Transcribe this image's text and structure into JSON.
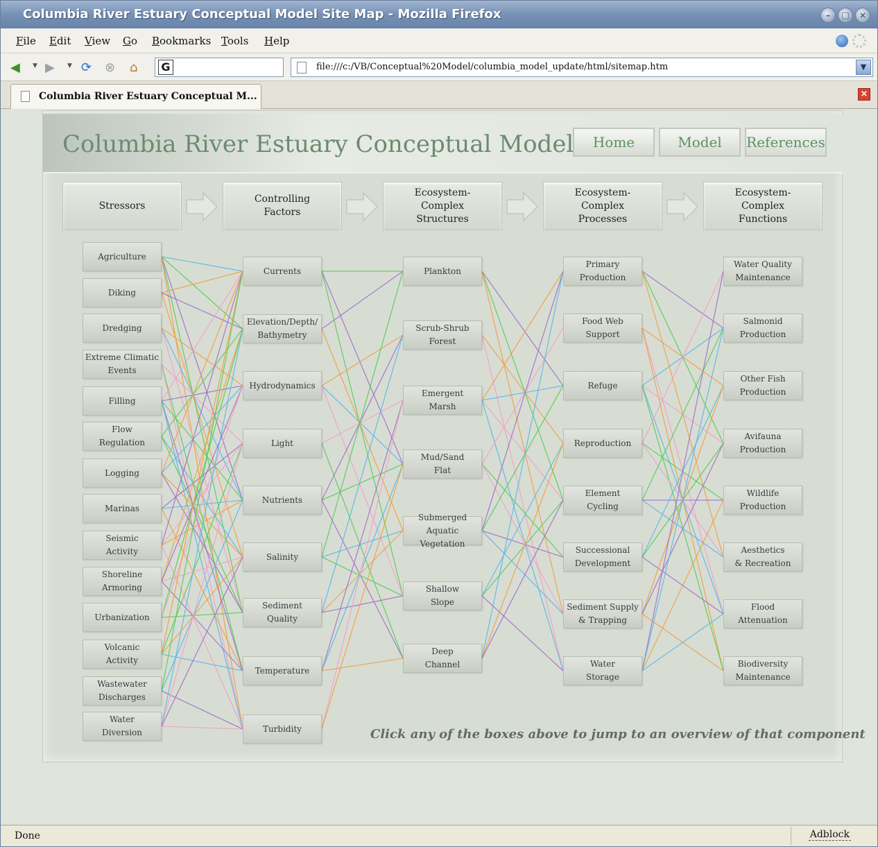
{
  "window": {
    "title": "Columbia River Estuary Conceptual Model Site Map - Mozilla Firefox",
    "controls": [
      "minimize",
      "maximize",
      "close"
    ]
  },
  "menu": [
    "File",
    "Edit",
    "View",
    "Go",
    "Bookmarks",
    "Tools",
    "Help"
  ],
  "toolbar": {
    "search_engine_glyph": "G",
    "url": "file:///c:/VB/Conceptual%20Model/columbia_model_update/html/sitemap.htm"
  },
  "tab": {
    "label": "Columbia River Estuary Conceptual M..."
  },
  "site": {
    "title": "Columbia River Estuary Conceptual Model",
    "nav": [
      "Home",
      "Model",
      "References"
    ]
  },
  "categories": [
    "Stressors",
    "Controlling\nFactors",
    "Ecosystem-\nComplex\nStructures",
    "Ecosystem-\nComplex\nProcesses",
    "Ecosystem-\nComplex\nFunctions"
  ],
  "columns": [
    [
      "Agriculture",
      "Diking",
      "Dredging",
      "Extreme Climatic\nEvents",
      "Filling",
      "Flow\nRegulation",
      "Logging",
      "Marinas",
      "Seismic\nActivity",
      "Shoreline\nArmoring",
      "Urbanization",
      "Volcanic\nActivity",
      "Wastewater\nDischarges",
      "Water\nDiversion"
    ],
    [
      "Currents",
      "Elevation/Depth/\nBathymetry",
      "Hydrodynamics",
      "Light",
      "Nutrients",
      "Salinity",
      "Sediment\nQuality",
      "Temperature",
      "Turbidity"
    ],
    [
      "Plankton",
      "Scrub-Shrub\nForest",
      "Emergent\nMarsh",
      "Mud/Sand\nFlat",
      "Submerged Aquatic\nVegetation",
      "Shallow\nSlope",
      "Deep\nChannel"
    ],
    [
      "Primary\nProduction",
      "Food Web\nSupport",
      "Refuge",
      "Reproduction",
      "Element\nCycling",
      "Successional\nDevelopment",
      "Sediment Supply\n& Trapping",
      "Water\nStorage"
    ],
    [
      "Water Quality\nMaintenance",
      "Salmonid\nProduction",
      "Other Fish\nProduction",
      "Avifauna\nProduction",
      "Wildlife\nProduction",
      "Aesthetics\n& Recreation",
      "Flood\nAttenuation",
      "Biodiversity\nMaintenance"
    ]
  ],
  "link_colors": [
    "#5ab9e3",
    "#55cc55",
    "#f2a0c5",
    "#f0a040",
    "#a070c8"
  ],
  "hint": "Click any of the boxes above to jump to an overview of that component",
  "status": {
    "text": "Done",
    "adblock": "Adblock"
  }
}
